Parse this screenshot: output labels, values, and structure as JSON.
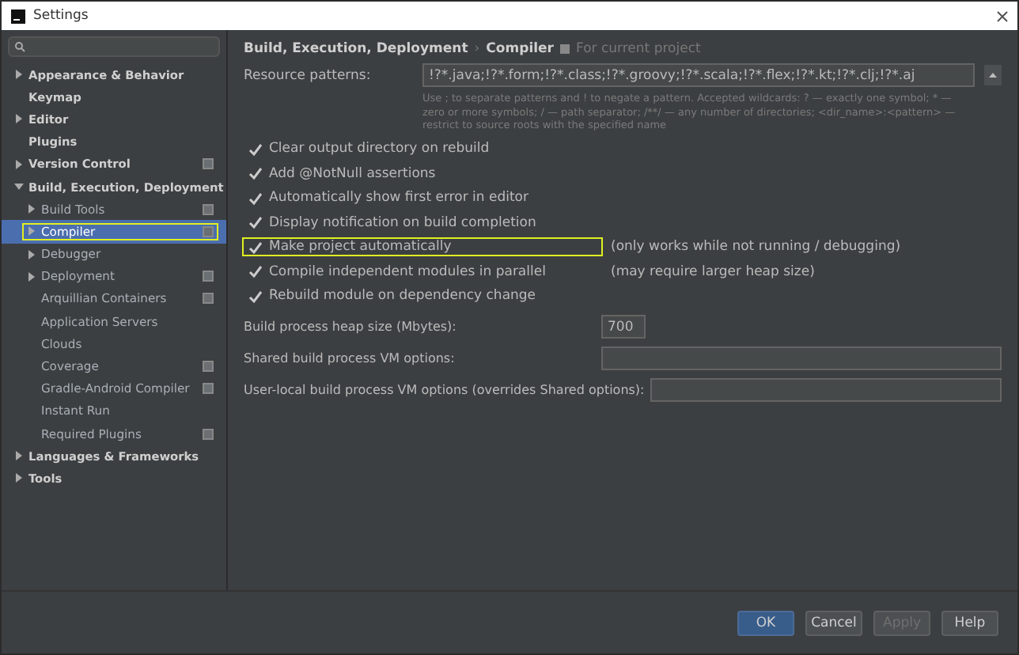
{
  "window": {
    "title": "Settings"
  },
  "sidebar": {
    "items": [
      {
        "label": "Appearance & Behavior",
        "expandable": true,
        "expanded": false,
        "selected": false,
        "project_icon": false,
        "highlighted": false
      },
      {
        "label": "Keymap",
        "expandable": false,
        "selected": false,
        "project_icon": false,
        "highlighted": false
      },
      {
        "label": "Editor",
        "expandable": true,
        "expanded": false,
        "selected": false,
        "project_icon": false,
        "highlighted": false
      },
      {
        "label": "Plugins",
        "expandable": false,
        "selected": false,
        "project_icon": false,
        "highlighted": false
      },
      {
        "label": "Version Control",
        "expandable": true,
        "expanded": false,
        "selected": false,
        "project_icon": true,
        "highlighted": false
      },
      {
        "label": "Build, Execution, Deployment",
        "expandable": true,
        "expanded": true,
        "selected": false,
        "project_icon": false,
        "highlighted": false,
        "children": [
          {
            "label": "Build Tools",
            "expandable": true,
            "expanded": false,
            "selected": false,
            "project_icon": true,
            "highlighted": false
          },
          {
            "label": "Compiler",
            "expandable": true,
            "expanded": false,
            "selected": true,
            "project_icon": true,
            "highlighted": true
          },
          {
            "label": "Debugger",
            "expandable": true,
            "expanded": false,
            "selected": false,
            "project_icon": false,
            "highlighted": false
          },
          {
            "label": "Deployment",
            "expandable": true,
            "expanded": false,
            "selected": false,
            "project_icon": true,
            "highlighted": false
          },
          {
            "label": "Arquillian Containers",
            "expandable": false,
            "selected": false,
            "project_icon": true,
            "highlighted": false
          },
          {
            "label": "Application Servers",
            "expandable": false,
            "selected": false,
            "project_icon": false,
            "highlighted": false
          },
          {
            "label": "Clouds",
            "expandable": false,
            "selected": false,
            "project_icon": false,
            "highlighted": false
          },
          {
            "label": "Coverage",
            "expandable": false,
            "selected": false,
            "project_icon": true,
            "highlighted": false
          },
          {
            "label": "Gradle-Android Compiler",
            "expandable": false,
            "selected": false,
            "project_icon": true,
            "highlighted": false
          },
          {
            "label": "Instant Run",
            "expandable": false,
            "selected": false,
            "project_icon": false,
            "highlighted": false
          },
          {
            "label": "Required Plugins",
            "expandable": false,
            "selected": false,
            "project_icon": true,
            "highlighted": false
          }
        ]
      },
      {
        "label": "Languages & Frameworks",
        "expandable": true,
        "expanded": false,
        "selected": false,
        "project_icon": false,
        "highlighted": false
      },
      {
        "label": "Tools",
        "expandable": true,
        "expanded": false,
        "selected": false,
        "project_icon": false,
        "highlighted": false
      }
    ]
  },
  "breadcrumb": {
    "path": "Build, Execution, Deployment",
    "separator": "›",
    "current": "Compiler",
    "scope": "For current project"
  },
  "resource_patterns": {
    "label": "Resource patterns:",
    "value": "!?*.java;!?*.form;!?*.class;!?*.groovy;!?*.scala;!?*.flex;!?*.kt;!?*.clj;!?*.aj",
    "hint": "Use ; to separate patterns and ! to negate a pattern. Accepted wildcards: ? — exactly one symbol; * — zero or more symbols; / — path separator; /**/ — any number of directories; <dir_name>:<pattern> — restrict to source roots with the specified name"
  },
  "options": [
    {
      "label": "Clear output directory on rebuild",
      "checked": true,
      "highlighted": false
    },
    {
      "label": "Add @NotNull assertions",
      "checked": true,
      "highlighted": false
    },
    {
      "label": "Automatically show first error in editor",
      "checked": true,
      "highlighted": false
    },
    {
      "label": "Display notification on build completion",
      "checked": true,
      "highlighted": false
    },
    {
      "label": "Make project automatically",
      "checked": true,
      "highlighted": true,
      "note": "(only works while not running / debugging)"
    },
    {
      "label": "Compile independent modules in parallel",
      "checked": true,
      "highlighted": false,
      "note": "(may require larger heap size)"
    },
    {
      "label": "Rebuild module on dependency change",
      "checked": true,
      "highlighted": false
    }
  ],
  "fields": [
    {
      "label": "Build process heap size (Mbytes):",
      "value": "700",
      "kind": "short"
    },
    {
      "label": "Shared build process VM options:",
      "kind": "wide"
    },
    {
      "label": "User-local build process VM options (overrides Shared options):",
      "kind": "wide"
    }
  ],
  "buttons": [
    {
      "label": "OK",
      "default": true,
      "disabled": false
    },
    {
      "label": "Cancel",
      "default": false,
      "disabled": false
    },
    {
      "label": "Apply",
      "default": false,
      "disabled": true
    },
    {
      "label": "Help",
      "default": false,
      "disabled": false
    }
  ]
}
